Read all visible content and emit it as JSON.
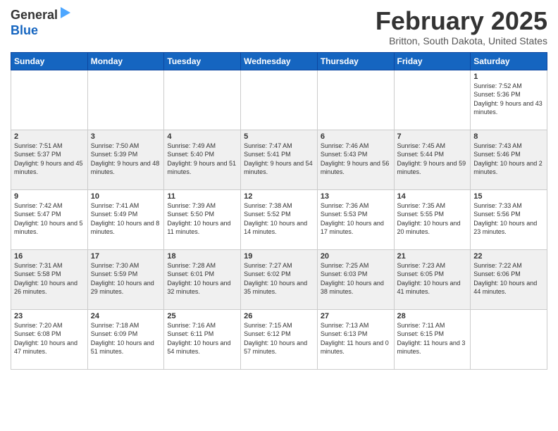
{
  "logo": {
    "general": "General",
    "blue": "Blue"
  },
  "header": {
    "title": "February 2025",
    "subtitle": "Britton, South Dakota, United States"
  },
  "days_of_week": [
    "Sunday",
    "Monday",
    "Tuesday",
    "Wednesday",
    "Thursday",
    "Friday",
    "Saturday"
  ],
  "weeks": [
    [
      {
        "day": "",
        "info": ""
      },
      {
        "day": "",
        "info": ""
      },
      {
        "day": "",
        "info": ""
      },
      {
        "day": "",
        "info": ""
      },
      {
        "day": "",
        "info": ""
      },
      {
        "day": "",
        "info": ""
      },
      {
        "day": "1",
        "info": "Sunrise: 7:52 AM\nSunset: 5:36 PM\nDaylight: 9 hours and 43 minutes."
      }
    ],
    [
      {
        "day": "2",
        "info": "Sunrise: 7:51 AM\nSunset: 5:37 PM\nDaylight: 9 hours and 45 minutes."
      },
      {
        "day": "3",
        "info": "Sunrise: 7:50 AM\nSunset: 5:39 PM\nDaylight: 9 hours and 48 minutes."
      },
      {
        "day": "4",
        "info": "Sunrise: 7:49 AM\nSunset: 5:40 PM\nDaylight: 9 hours and 51 minutes."
      },
      {
        "day": "5",
        "info": "Sunrise: 7:47 AM\nSunset: 5:41 PM\nDaylight: 9 hours and 54 minutes."
      },
      {
        "day": "6",
        "info": "Sunrise: 7:46 AM\nSunset: 5:43 PM\nDaylight: 9 hours and 56 minutes."
      },
      {
        "day": "7",
        "info": "Sunrise: 7:45 AM\nSunset: 5:44 PM\nDaylight: 9 hours and 59 minutes."
      },
      {
        "day": "8",
        "info": "Sunrise: 7:43 AM\nSunset: 5:46 PM\nDaylight: 10 hours and 2 minutes."
      }
    ],
    [
      {
        "day": "9",
        "info": "Sunrise: 7:42 AM\nSunset: 5:47 PM\nDaylight: 10 hours and 5 minutes."
      },
      {
        "day": "10",
        "info": "Sunrise: 7:41 AM\nSunset: 5:49 PM\nDaylight: 10 hours and 8 minutes."
      },
      {
        "day": "11",
        "info": "Sunrise: 7:39 AM\nSunset: 5:50 PM\nDaylight: 10 hours and 11 minutes."
      },
      {
        "day": "12",
        "info": "Sunrise: 7:38 AM\nSunset: 5:52 PM\nDaylight: 10 hours and 14 minutes."
      },
      {
        "day": "13",
        "info": "Sunrise: 7:36 AM\nSunset: 5:53 PM\nDaylight: 10 hours and 17 minutes."
      },
      {
        "day": "14",
        "info": "Sunrise: 7:35 AM\nSunset: 5:55 PM\nDaylight: 10 hours and 20 minutes."
      },
      {
        "day": "15",
        "info": "Sunrise: 7:33 AM\nSunset: 5:56 PM\nDaylight: 10 hours and 23 minutes."
      }
    ],
    [
      {
        "day": "16",
        "info": "Sunrise: 7:31 AM\nSunset: 5:58 PM\nDaylight: 10 hours and 26 minutes."
      },
      {
        "day": "17",
        "info": "Sunrise: 7:30 AM\nSunset: 5:59 PM\nDaylight: 10 hours and 29 minutes."
      },
      {
        "day": "18",
        "info": "Sunrise: 7:28 AM\nSunset: 6:01 PM\nDaylight: 10 hours and 32 minutes."
      },
      {
        "day": "19",
        "info": "Sunrise: 7:27 AM\nSunset: 6:02 PM\nDaylight: 10 hours and 35 minutes."
      },
      {
        "day": "20",
        "info": "Sunrise: 7:25 AM\nSunset: 6:03 PM\nDaylight: 10 hours and 38 minutes."
      },
      {
        "day": "21",
        "info": "Sunrise: 7:23 AM\nSunset: 6:05 PM\nDaylight: 10 hours and 41 minutes."
      },
      {
        "day": "22",
        "info": "Sunrise: 7:22 AM\nSunset: 6:06 PM\nDaylight: 10 hours and 44 minutes."
      }
    ],
    [
      {
        "day": "23",
        "info": "Sunrise: 7:20 AM\nSunset: 6:08 PM\nDaylight: 10 hours and 47 minutes."
      },
      {
        "day": "24",
        "info": "Sunrise: 7:18 AM\nSunset: 6:09 PM\nDaylight: 10 hours and 51 minutes."
      },
      {
        "day": "25",
        "info": "Sunrise: 7:16 AM\nSunset: 6:11 PM\nDaylight: 10 hours and 54 minutes."
      },
      {
        "day": "26",
        "info": "Sunrise: 7:15 AM\nSunset: 6:12 PM\nDaylight: 10 hours and 57 minutes."
      },
      {
        "day": "27",
        "info": "Sunrise: 7:13 AM\nSunset: 6:13 PM\nDaylight: 11 hours and 0 minutes."
      },
      {
        "day": "28",
        "info": "Sunrise: 7:11 AM\nSunset: 6:15 PM\nDaylight: 11 hours and 3 minutes."
      },
      {
        "day": "",
        "info": ""
      }
    ]
  ]
}
